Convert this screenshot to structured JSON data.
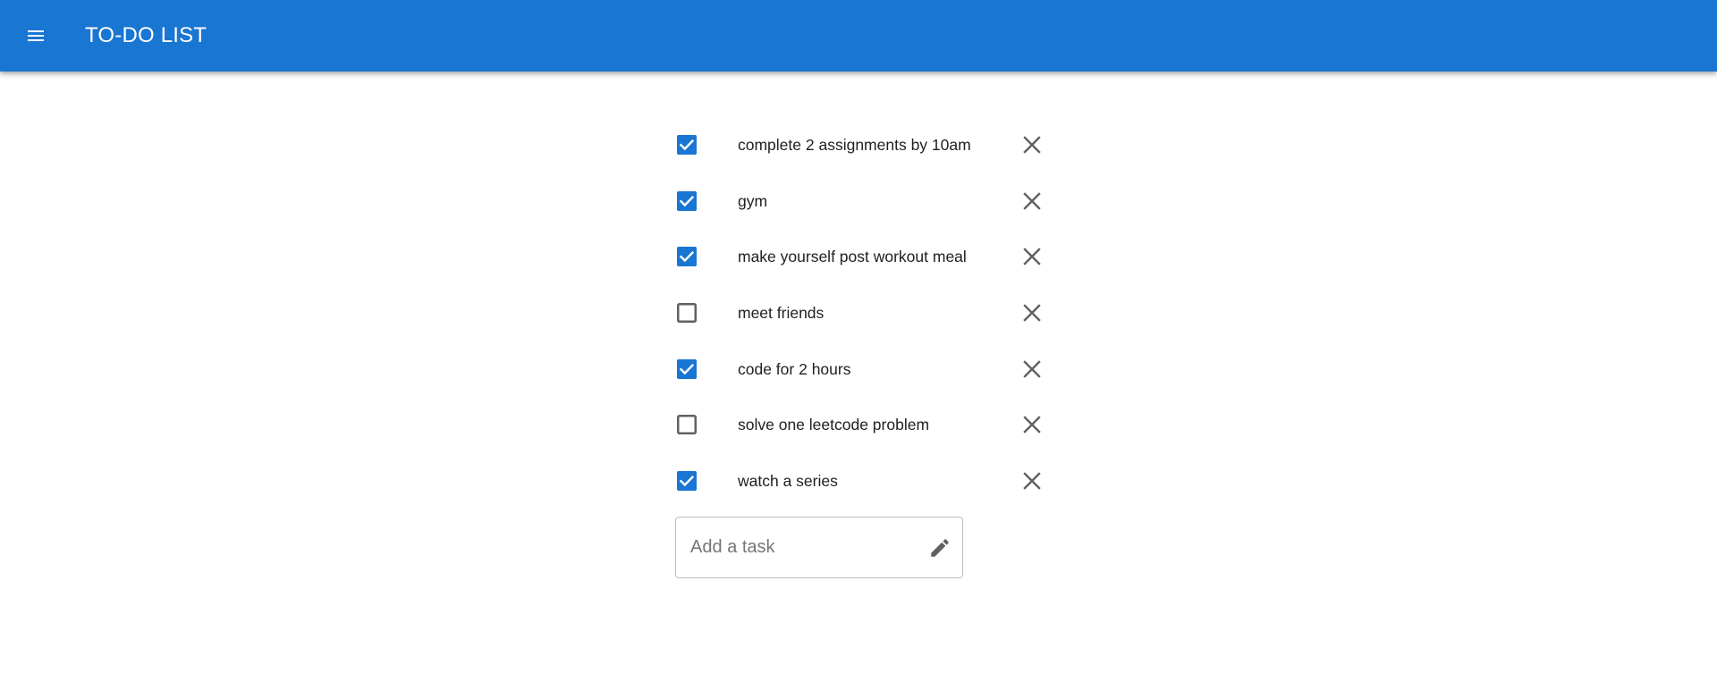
{
  "appbar": {
    "title": "TO-DO LIST",
    "color": "#1976d2",
    "menu_icon": "menu-icon"
  },
  "tasks": [
    {
      "text": "complete 2 assignments by 10am",
      "done": true
    },
    {
      "text": "gym",
      "done": true
    },
    {
      "text": "make yourself post workout meal",
      "done": true
    },
    {
      "text": "meet friends",
      "done": false
    },
    {
      "text": "code for 2 hours",
      "done": true
    },
    {
      "text": "solve one leetcode problem",
      "done": false
    },
    {
      "text": "watch a series",
      "done": true
    }
  ],
  "add_task": {
    "value": "",
    "placeholder": "Add a task",
    "icon": "pencil-icon"
  },
  "colors": {
    "checked": "#1976d2",
    "unchecked_border": "#616161",
    "delete_icon": "#616161"
  }
}
